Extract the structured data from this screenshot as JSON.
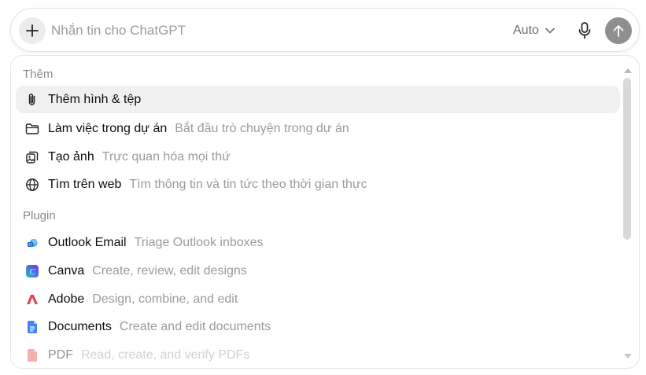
{
  "composer": {
    "placeholder": "Nhắn tin cho ChatGPT",
    "model_label": "Auto",
    "plus_icon": "plus-icon",
    "mic_icon": "microphone-icon",
    "send_icon": "arrow-up-icon"
  },
  "menu": {
    "sections": [
      {
        "label": "Thêm",
        "items": [
          {
            "label": "Thêm hình & tệp",
            "desc": "",
            "icon": "paperclip-icon",
            "active": true
          },
          {
            "label": "Làm việc trong dự án",
            "desc": "Bắt đầu trò chuyện trong dự án",
            "icon": "folder-icon"
          },
          {
            "label": "Tạo ảnh",
            "desc": "Trực quan hóa mọi thứ",
            "icon": "image-sparkle-icon"
          },
          {
            "label": "Tìm trên web",
            "desc": "Tìm thông tin và tin tức theo thời gian thực",
            "icon": "globe-icon"
          }
        ]
      },
      {
        "label": "Plugin",
        "items": [
          {
            "label": "Outlook Email",
            "desc": "Triage Outlook inboxes",
            "icon": "outlook-icon"
          },
          {
            "label": "Canva",
            "desc": "Create, review, edit designs",
            "icon": "canva-icon"
          },
          {
            "label": "Adobe",
            "desc": "Design, combine, and edit",
            "icon": "adobe-icon"
          },
          {
            "label": "Documents",
            "desc": "Create and edit documents",
            "icon": "documents-icon"
          },
          {
            "label": "PDF",
            "desc": "Read, create, and verify PDFs",
            "icon": "pdf-icon"
          }
        ]
      }
    ]
  },
  "colors": {
    "accent_send": "#8f8f8f",
    "hover_bg": "#f0f0f0",
    "canva": "#7d2ae8",
    "adobe": "#e34850",
    "documents": "#4285f4",
    "pdf": "#e0554a"
  }
}
